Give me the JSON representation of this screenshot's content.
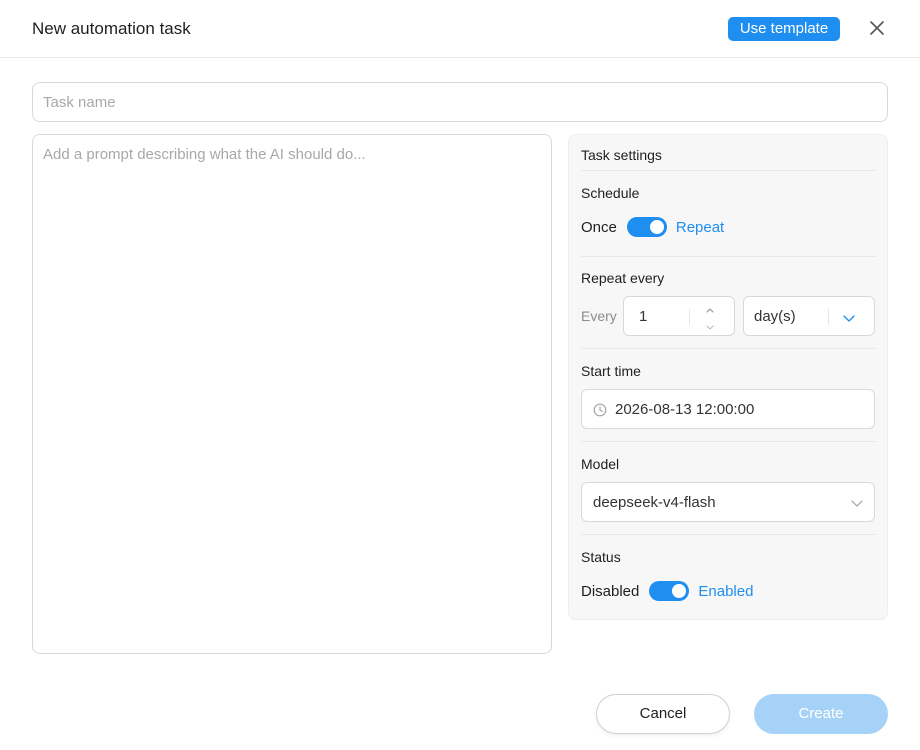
{
  "dialog": {
    "title": "New automation task",
    "use_template_label": "Use template",
    "close_icon": "close-icon"
  },
  "form": {
    "task_name_placeholder": "Task name",
    "task_name_value": "",
    "prompt_placeholder": "Add a prompt describing what the AI should do...",
    "prompt_value": ""
  },
  "settings": {
    "title": "Task settings",
    "schedule": {
      "label": "Schedule",
      "off_label": "Once",
      "on_label": "Repeat",
      "value": "Repeat"
    },
    "repeat": {
      "label": "Repeat every",
      "prefix": "Every",
      "interval": "1",
      "unit": "day(s)"
    },
    "start_time": {
      "label": "Start time",
      "value": "2026-08-13 12:00:00"
    },
    "model": {
      "label": "Model",
      "value": "deepseek-v4-flash"
    },
    "status": {
      "label": "Status",
      "off_label": "Disabled",
      "on_label": "Enabled",
      "value": "Enabled"
    }
  },
  "footer": {
    "cancel_label": "Cancel",
    "create_label": "Create"
  },
  "colors": {
    "accent": "#1e8ff0",
    "create_disabled": "#a7d2f8",
    "panel_bg": "#f7f7f7",
    "border": "#d9d9d9"
  }
}
